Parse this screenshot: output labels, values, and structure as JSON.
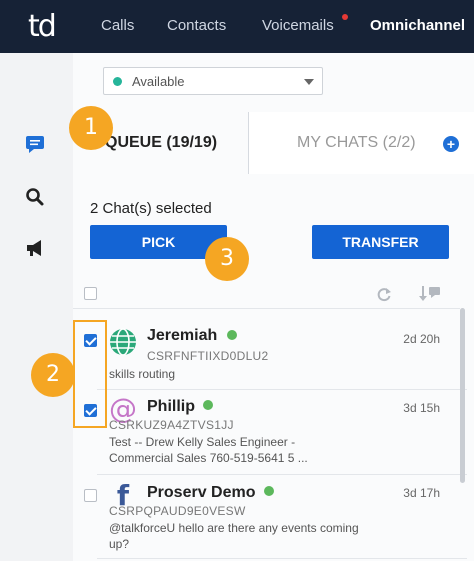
{
  "app": {
    "logo_text": "td"
  },
  "nav": {
    "items": [
      {
        "label": "Calls"
      },
      {
        "label": "Contacts"
      },
      {
        "label": "Voicemails",
        "has_notification": true
      },
      {
        "label": "Omnichannel",
        "active": true
      }
    ]
  },
  "sidebar": {
    "icons": [
      "chat-icon",
      "search-icon",
      "megaphone-icon"
    ]
  },
  "status": {
    "value": "Available",
    "color": "#26b59a"
  },
  "tabs": {
    "queue": "QUEUE (19/19)",
    "my_chats": "MY CHATS (2/2)"
  },
  "selection": {
    "text": "2 Chat(s) selected"
  },
  "buttons": {
    "pick": "PICK",
    "transfer": "TRANSFER"
  },
  "chats": [
    {
      "name": "Jeremiah",
      "id": "CSRFNFTIIXD0DLU2",
      "message": "skills routing",
      "time": "2d 20h",
      "checked": true,
      "source_icon": "globe-icon"
    },
    {
      "name": "Phillip",
      "id": "CSRKUZ9A4ZTVS1JJ",
      "message": "Test -- Drew Kelly Sales Engineer - Commercial Sales 760-519-5641 5 ...",
      "time": "3d 15h",
      "checked": true,
      "source_icon": "at-sign-icon"
    },
    {
      "name": "Proserv Demo",
      "id": "CSRPQPAUD9E0VESW",
      "message": "@talkforceU hello are there any events coming up?",
      "time": "3d 17h",
      "checked": false,
      "source_icon": "facebook-icon"
    }
  ],
  "callouts": [
    "1",
    "2",
    "3"
  ],
  "colors": {
    "nav_bg": "#162236",
    "accent": "#1464d4",
    "callout": "#f5a623",
    "online": "#5cb85c"
  }
}
